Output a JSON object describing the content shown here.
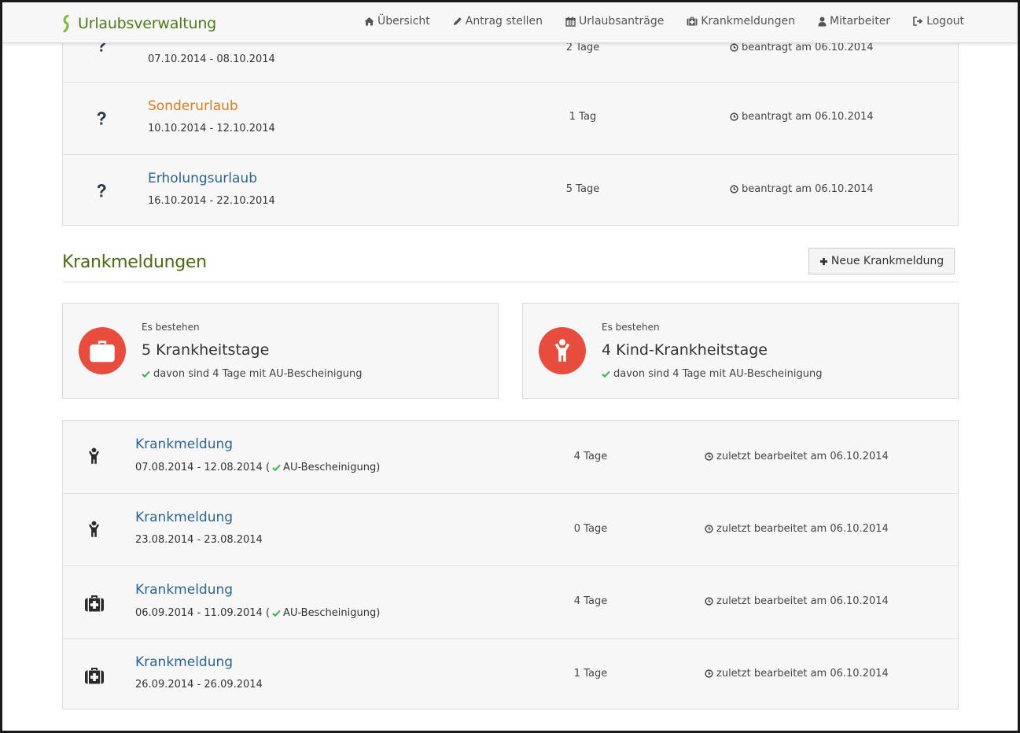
{
  "nav": {
    "brand": "Urlaubsverwaltung",
    "items": [
      {
        "label": "Übersicht",
        "icon": "home-icon"
      },
      {
        "label": "Antrag stellen",
        "icon": "pencil-icon"
      },
      {
        "label": "Urlaubsanträge",
        "icon": "calendar-icon"
      },
      {
        "label": "Krankmeldungen",
        "icon": "medkit-icon"
      },
      {
        "label": "Mitarbeiter",
        "icon": "user-icon"
      },
      {
        "label": "Logout",
        "icon": "sign-out-icon"
      }
    ]
  },
  "vacations": [
    {
      "title": "",
      "dates": "07.10.2014 - 08.10.2014",
      "days": "2 Tage",
      "status": "beantragt am 06.10.2014",
      "icon": "question-icon"
    },
    {
      "title": "Sonderurlaub",
      "dates": "10.10.2014 - 12.10.2014",
      "days": "1 Tag",
      "status": "beantragt am 06.10.2014",
      "icon": "question-icon",
      "color": "#e07a1f"
    },
    {
      "title": "Erholungsurlaub",
      "dates": "16.10.2014 - 22.10.2014",
      "days": "5 Tage",
      "status": "beantragt am 06.10.2014",
      "icon": "question-icon",
      "color": "#2a6496"
    }
  ],
  "sick": {
    "title": "Krankmeldungen",
    "new_button": "Neue Krankmeldung",
    "stats": [
      {
        "label": "Es bestehen",
        "value": "5 Krankheitstage",
        "sub": "davon sind 4 Tage mit AU-Bescheinigung",
        "icon": "medkit-icon"
      },
      {
        "label": "Es bestehen",
        "value": "4 Kind-Krankheitstage",
        "sub": "davon sind 4 Tage mit AU-Bescheinigung",
        "icon": "child-icon"
      }
    ],
    "rows": [
      {
        "title": "Krankmeldung",
        "dates": "07.08.2014 - 12.08.2014",
        "au": "AU-Bescheinigung",
        "days": "4 Tage",
        "status": "zuletzt bearbeitet am 06.10.2014",
        "icon": "child-icon"
      },
      {
        "title": "Krankmeldung",
        "dates": "23.08.2014 - 23.08.2014",
        "au": "",
        "days": "0 Tage",
        "status": "zuletzt bearbeitet am 06.10.2014",
        "icon": "child-icon"
      },
      {
        "title": "Krankmeldung",
        "dates": "06.09.2014 - 11.09.2014",
        "au": "AU-Bescheinigung",
        "days": "4 Tage",
        "status": "zuletzt bearbeitet am 06.10.2014",
        "icon": "medkit-icon"
      },
      {
        "title": "Krankmeldung",
        "dates": "26.09.2014 - 26.09.2014",
        "au": "",
        "days": "1 Tage",
        "status": "zuletzt bearbeitet am 06.10.2014",
        "icon": "medkit-icon"
      }
    ]
  },
  "colors": {
    "brand": "#4b7a1a",
    "link": "#2a6496",
    "accent": "#e74c3c",
    "check": "#3cb84a"
  }
}
